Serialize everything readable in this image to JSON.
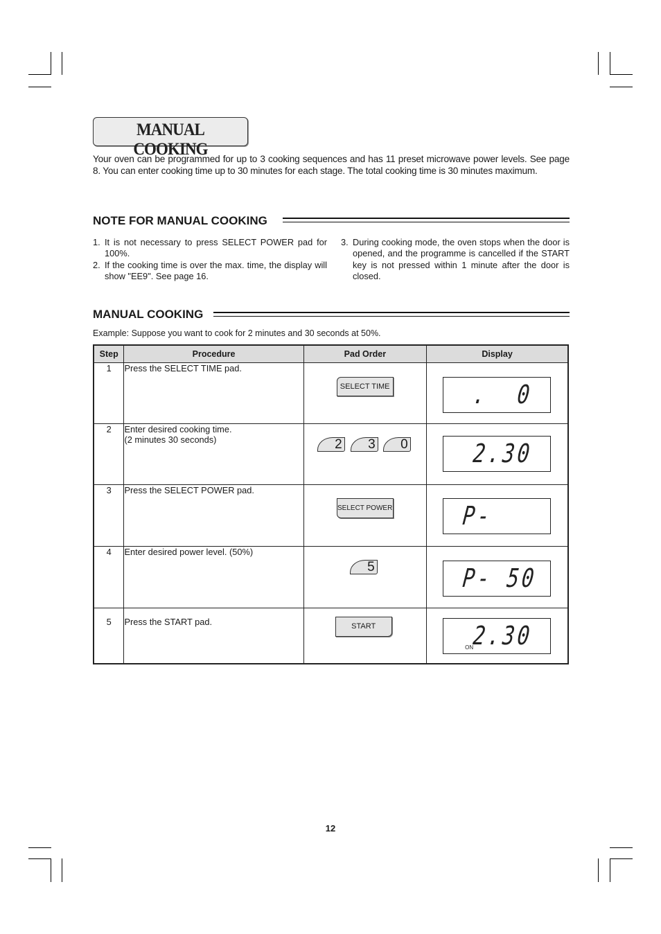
{
  "page": {
    "title": "MANUAL COOKING",
    "intro": "Your oven can be programmed for up to 3 cooking sequences and has 11 preset microwave power levels. See page 8. You can enter cooking time up to 30 minutes for each stage. The total cooking time is 30 minutes maximum.",
    "page_number": "12"
  },
  "notes_section": {
    "heading": "NOTE FOR MANUAL COOKING",
    "items": [
      {
        "num": "1.",
        "text": "It is not necessary to press SELECT POWER pad for 100%."
      },
      {
        "num": "2.",
        "text": "If the cooking time is over the max. time, the display will show \"EE9\". See page 16."
      },
      {
        "num": "3.",
        "text": "During cooking mode, the oven stops when the door is opened, and the programme is cancelled if the START key is not pressed within 1 minute after the door is closed."
      }
    ]
  },
  "manual_section": {
    "heading": "MANUAL COOKING",
    "example": "Example: Suppose you want to cook for 2 minutes and 30 seconds at 50%.",
    "table": {
      "headers": [
        "Step",
        "Procedure",
        "Pad Order",
        "Display"
      ],
      "rows": [
        {
          "step": "1",
          "procedure": "Press the SELECT TIME pad.",
          "procedure2": "",
          "pads": [
            "SELECT  TIME"
          ],
          "display": ".  0",
          "display_indicator": ""
        },
        {
          "step": "2",
          "procedure": "Enter desired cooking time.",
          "procedure2": "(2 minutes 30 seconds)",
          "pads": [
            "2",
            "3",
            "0"
          ],
          "display": "2.30",
          "display_indicator": ""
        },
        {
          "step": "3",
          "procedure": "Press the SELECT POWER pad.",
          "procedure2": "",
          "pads": [
            "SELECT  POWER"
          ],
          "display": "P-",
          "display_indicator": ""
        },
        {
          "step": "4",
          "procedure": "Enter desired power level. (50%)",
          "procedure2": "",
          "pads": [
            "5"
          ],
          "display": "P- 50",
          "display_indicator": ""
        },
        {
          "step": "5",
          "procedure": "Press the START pad.",
          "procedure2": "",
          "pads": [
            "START"
          ],
          "display": "2.30",
          "display_indicator": "ON"
        }
      ]
    }
  }
}
